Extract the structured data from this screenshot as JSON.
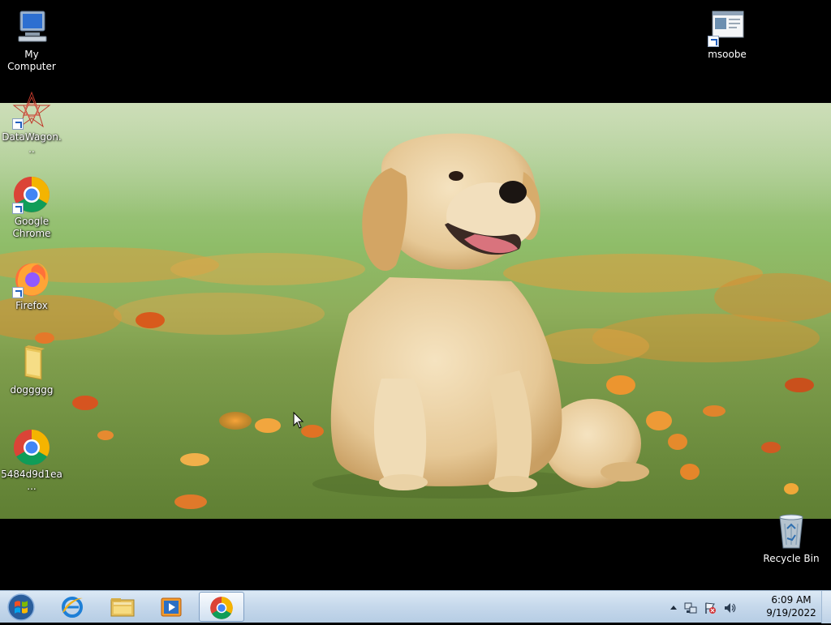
{
  "desktop": {
    "icons": [
      {
        "label": "My Computer"
      },
      {
        "label": "msoobe"
      },
      {
        "label": "DataWagon..."
      },
      {
        "label": "Google Chrome"
      },
      {
        "label": "Firefox"
      },
      {
        "label": "doggggg"
      },
      {
        "label": "5484d9d1ea..."
      },
      {
        "label": "Recycle Bin"
      }
    ],
    "wallpaper": "golden-retriever-puppy-in-grass-with-orange-leaves"
  },
  "taskbar": {
    "start": "windows-orb-icon",
    "pinned": [
      {
        "icon": "internet-explorer-icon"
      },
      {
        "icon": "file-explorer-icon"
      },
      {
        "icon": "media-player-icon"
      },
      {
        "icon": "chrome-icon",
        "active": true
      }
    ],
    "tray": {
      "icons": [
        "show-hidden-icons-arrow",
        "network-icon",
        "action-center-flag-icon",
        "volume-icon"
      ],
      "time": "6:09 AM",
      "date": "9/19/2022"
    }
  },
  "colors": {
    "taskbar_top": "#dce9f5",
    "taskbar_bottom": "#b6cde4",
    "desktop_background": "#000000"
  }
}
